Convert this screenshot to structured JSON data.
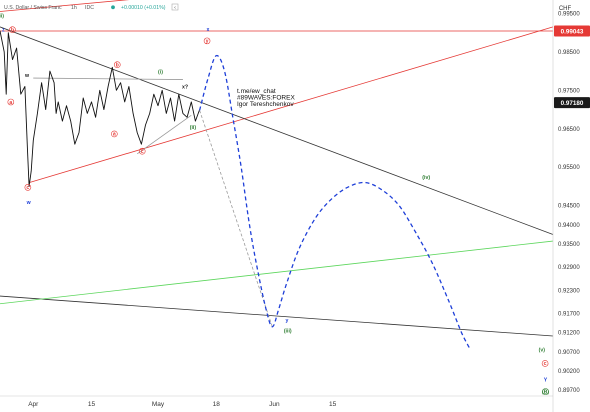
{
  "header": {
    "symbol": "U.S. Dollar / Swiss Franc",
    "interval": "1h",
    "source": "IDC",
    "change": "+0.00010 (+0.01%)",
    "collapse_glyph": "‹"
  },
  "author": {
    "line1": "t.me/ew_chat",
    "line2": "#89WAVES:FOREX",
    "line3": "Igor Tereshchenkov"
  },
  "chart_data": {
    "type": "line",
    "currency": "CHF",
    "time_labels": [
      "Apr",
      "15",
      "May",
      "18",
      "Jun",
      "15"
    ],
    "time_label_positions_days": [
      8,
      22,
      38,
      52,
      66,
      80
    ],
    "price_ticks": [
      "0.99500",
      "0.98500",
      "0.97500",
      "0.96500",
      "0.95500",
      "0.94500",
      "0.94000",
      "0.93500",
      "0.92900",
      "0.92300",
      "0.91700",
      "0.91200",
      "0.90700",
      "0.90200",
      "0.89700"
    ],
    "price_tick_values": [
      0.995,
      0.985,
      0.975,
      0.965,
      0.955,
      0.945,
      0.94,
      0.935,
      0.929,
      0.923,
      0.917,
      0.912,
      0.907,
      0.902,
      0.897
    ],
    "ylim": [
      0.8955,
      0.9985
    ],
    "xlim_days": [
      0,
      133
    ],
    "price_badges": [
      {
        "value": 0.99043,
        "label": "0.99043",
        "color": "#e53935"
      },
      {
        "value": 0.9718,
        "label": "0.97180",
        "color": "#1a1a1a"
      }
    ],
    "price_series": [
      [
        0,
        0.9905
      ],
      [
        1,
        0.985
      ],
      [
        1.5,
        0.974
      ],
      [
        2,
        0.99
      ],
      [
        3,
        0.983
      ],
      [
        4,
        0.986
      ],
      [
        5,
        0.974
      ],
      [
        6,
        0.976
      ],
      [
        6.6,
        0.96
      ],
      [
        7,
        0.95
      ],
      [
        7.5,
        0.954
      ],
      [
        8,
        0.962
      ],
      [
        9,
        0.969
      ],
      [
        10,
        0.977
      ],
      [
        11,
        0.97
      ],
      [
        12,
        0.98
      ],
      [
        13,
        0.977
      ],
      [
        13.5,
        0.969
      ],
      [
        14,
        0.972
      ],
      [
        15,
        0.967
      ],
      [
        16,
        0.971
      ],
      [
        17,
        0.967
      ],
      [
        18,
        0.961
      ],
      [
        19,
        0.964
      ],
      [
        20,
        0.973
      ],
      [
        21,
        0.969
      ],
      [
        22,
        0.972
      ],
      [
        23,
        0.968
      ],
      [
        24,
        0.975
      ],
      [
        25,
        0.97
      ],
      [
        26,
        0.976
      ],
      [
        27,
        0.981
      ],
      [
        28,
        0.975
      ],
      [
        29,
        0.977
      ],
      [
        30,
        0.972
      ],
      [
        31,
        0.976
      ],
      [
        32,
        0.969
      ],
      [
        33,
        0.964
      ],
      [
        34,
        0.961
      ],
      [
        35,
        0.966
      ],
      [
        36,
        0.969
      ],
      [
        37,
        0.974
      ],
      [
        38,
        0.971
      ],
      [
        39,
        0.975
      ],
      [
        40,
        0.969
      ],
      [
        41,
        0.973
      ],
      [
        42,
        0.967
      ],
      [
        43,
        0.974
      ],
      [
        44,
        0.969
      ],
      [
        45,
        0.968
      ],
      [
        46,
        0.972
      ],
      [
        47,
        0.967
      ],
      [
        48,
        0.97
      ]
    ],
    "projection": [
      [
        48,
        0.9698
      ],
      [
        50,
        0.978
      ],
      [
        52,
        0.984
      ],
      [
        54,
        0.98
      ],
      [
        56,
        0.968
      ],
      [
        58,
        0.955
      ],
      [
        60,
        0.94
      ],
      [
        62,
        0.928
      ],
      [
        64,
        0.918
      ],
      [
        65.5,
        0.9135
      ],
      [
        67,
        0.918
      ],
      [
        69,
        0.925
      ],
      [
        72,
        0.934
      ],
      [
        76,
        0.942
      ],
      [
        80,
        0.947
      ],
      [
        84,
        0.95
      ],
      [
        88,
        0.951
      ],
      [
        92,
        0.949
      ],
      [
        96,
        0.945
      ],
      [
        100,
        0.938
      ],
      [
        104,
        0.93
      ],
      [
        108,
        0.92
      ],
      [
        111,
        0.912
      ],
      [
        113,
        0.9078
      ]
    ],
    "projection_color": "#1e3fd8",
    "dashed_gray": {
      "from": [
        48,
        0.9698
      ],
      "to": [
        65.5,
        0.9135
      ]
    },
    "trendlines": [
      {
        "name": "Upper channel",
        "color": "#e53935",
        "from": [
          0,
          0.9955
        ],
        "to": [
          75,
          1.003
        ]
      },
      {
        "name": "Lower channel",
        "color": "#e53935",
        "from": [
          7,
          0.951
        ],
        "to": [
          133,
          0.9915
        ]
      },
      {
        "name": "Upper black",
        "color": "#333333",
        "from": [
          0,
          0.9915
        ],
        "to": [
          133,
          0.9375
        ]
      },
      {
        "name": "Lower black",
        "color": "#333333",
        "from": [
          0,
          0.9215
        ],
        "to": [
          133,
          0.9111
        ]
      },
      {
        "name": "Green",
        "color": "#5cd65c",
        "from": [
          0,
          0.9195
        ],
        "to": [
          133,
          0.9358
        ]
      },
      {
        "name": "Gray top",
        "color": "#9a9a9a",
        "from": [
          8,
          0.9782
        ],
        "to": [
          44,
          0.9778
        ]
      },
      {
        "name": "Gray lower",
        "color": "#9a9a9a",
        "from": [
          33,
          0.9585
        ],
        "to": [
          46,
          0.9685
        ]
      }
    ],
    "horizontal_lines": [
      {
        "value": 0.99043,
        "color": "#e53935"
      }
    ],
    "wave_labels": [
      {
        "text": "(ii)",
        "x": 0.2,
        "y": 0.994,
        "color": "#2e7d32",
        "style": "text"
      },
      {
        "text": "z",
        "x": 0.8,
        "y": 0.9903,
        "color": "#1e3fd8",
        "style": "text"
      },
      {
        "text": "b",
        "x": 3.0,
        "y": 0.9903,
        "color": "#e53935",
        "style": "circle"
      },
      {
        "text": "a",
        "x": 2.6,
        "y": 0.9715,
        "color": "#e53935",
        "style": "circle"
      },
      {
        "text": "w",
        "x": 6.5,
        "y": 0.9785,
        "color": "#1a1a1a",
        "style": "text"
      },
      {
        "text": "c",
        "x": 6.7,
        "y": 0.9493,
        "color": "#e53935",
        "style": "circle"
      },
      {
        "text": "w",
        "x": 6.9,
        "y": 0.9455,
        "color": "#1e3fd8",
        "style": "text"
      },
      {
        "text": "b",
        "x": 28.2,
        "y": 0.9812,
        "color": "#e53935",
        "style": "circle"
      },
      {
        "text": "a",
        "x": 27.5,
        "y": 0.9632,
        "color": "#e53935",
        "style": "circle"
      },
      {
        "text": "c",
        "x": 34.2,
        "y": 0.9587,
        "color": "#e53935",
        "style": "circle"
      },
      {
        "text": "(i)",
        "x": 38.6,
        "y": 0.9794,
        "color": "#2e7d32",
        "style": "text"
      },
      {
        "text": "x?",
        "x": 44.5,
        "y": 0.9755,
        "color": "#1a1a1a",
        "style": "text"
      },
      {
        "text": "(ii)",
        "x": 46.4,
        "y": 0.965,
        "color": "#2e7d32",
        "style": "text"
      },
      {
        "text": "x",
        "x": 50.0,
        "y": 0.9904,
        "color": "#1e3fd8",
        "style": "text"
      },
      {
        "text": "y",
        "x": 49.8,
        "y": 0.9874,
        "color": "#e53935",
        "style": "circle"
      },
      {
        "text": "(iv)",
        "x": 102.5,
        "y": 0.952,
        "color": "#2e7d32",
        "style": "text"
      },
      {
        "text": "y",
        "x": 69.0,
        "y": 0.9148,
        "color": "#1e3fd8",
        "style": "text"
      },
      {
        "text": "(iii)",
        "x": 69.2,
        "y": 0.912,
        "color": "#2e7d32",
        "style": "text"
      },
      {
        "text": "(v)",
        "x": 130.3,
        "y": 0.9071,
        "color": "#2e7d32",
        "style": "text"
      },
      {
        "text": "c",
        "x": 131.1,
        "y": 0.9035,
        "color": "#e53935",
        "style": "circle"
      },
      {
        "text": "Y",
        "x": 131.2,
        "y": 0.8993,
        "color": "#1e3fd8",
        "style": "text"
      },
      {
        "text": "(B)",
        "x": 131.2,
        "y": 0.8962,
        "color": "#2e7d32",
        "style": "circle"
      }
    ]
  }
}
